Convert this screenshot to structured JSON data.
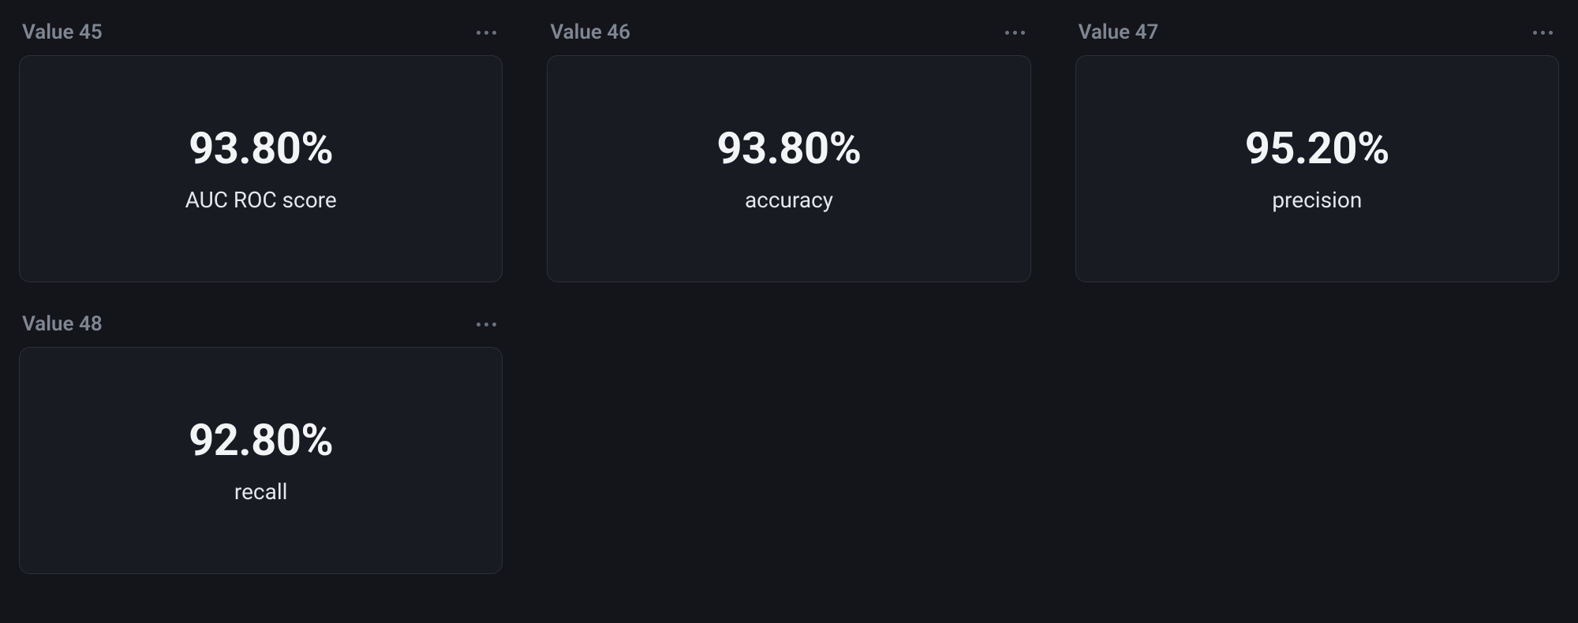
{
  "cards": [
    {
      "title": "Value 45",
      "value": "93.80%",
      "label": "AUC ROC score"
    },
    {
      "title": "Value 46",
      "value": "93.80%",
      "label": "accuracy"
    },
    {
      "title": "Value 47",
      "value": "95.20%",
      "label": "precision"
    },
    {
      "title": "Value 48",
      "value": "92.80%",
      "label": "recall"
    }
  ]
}
